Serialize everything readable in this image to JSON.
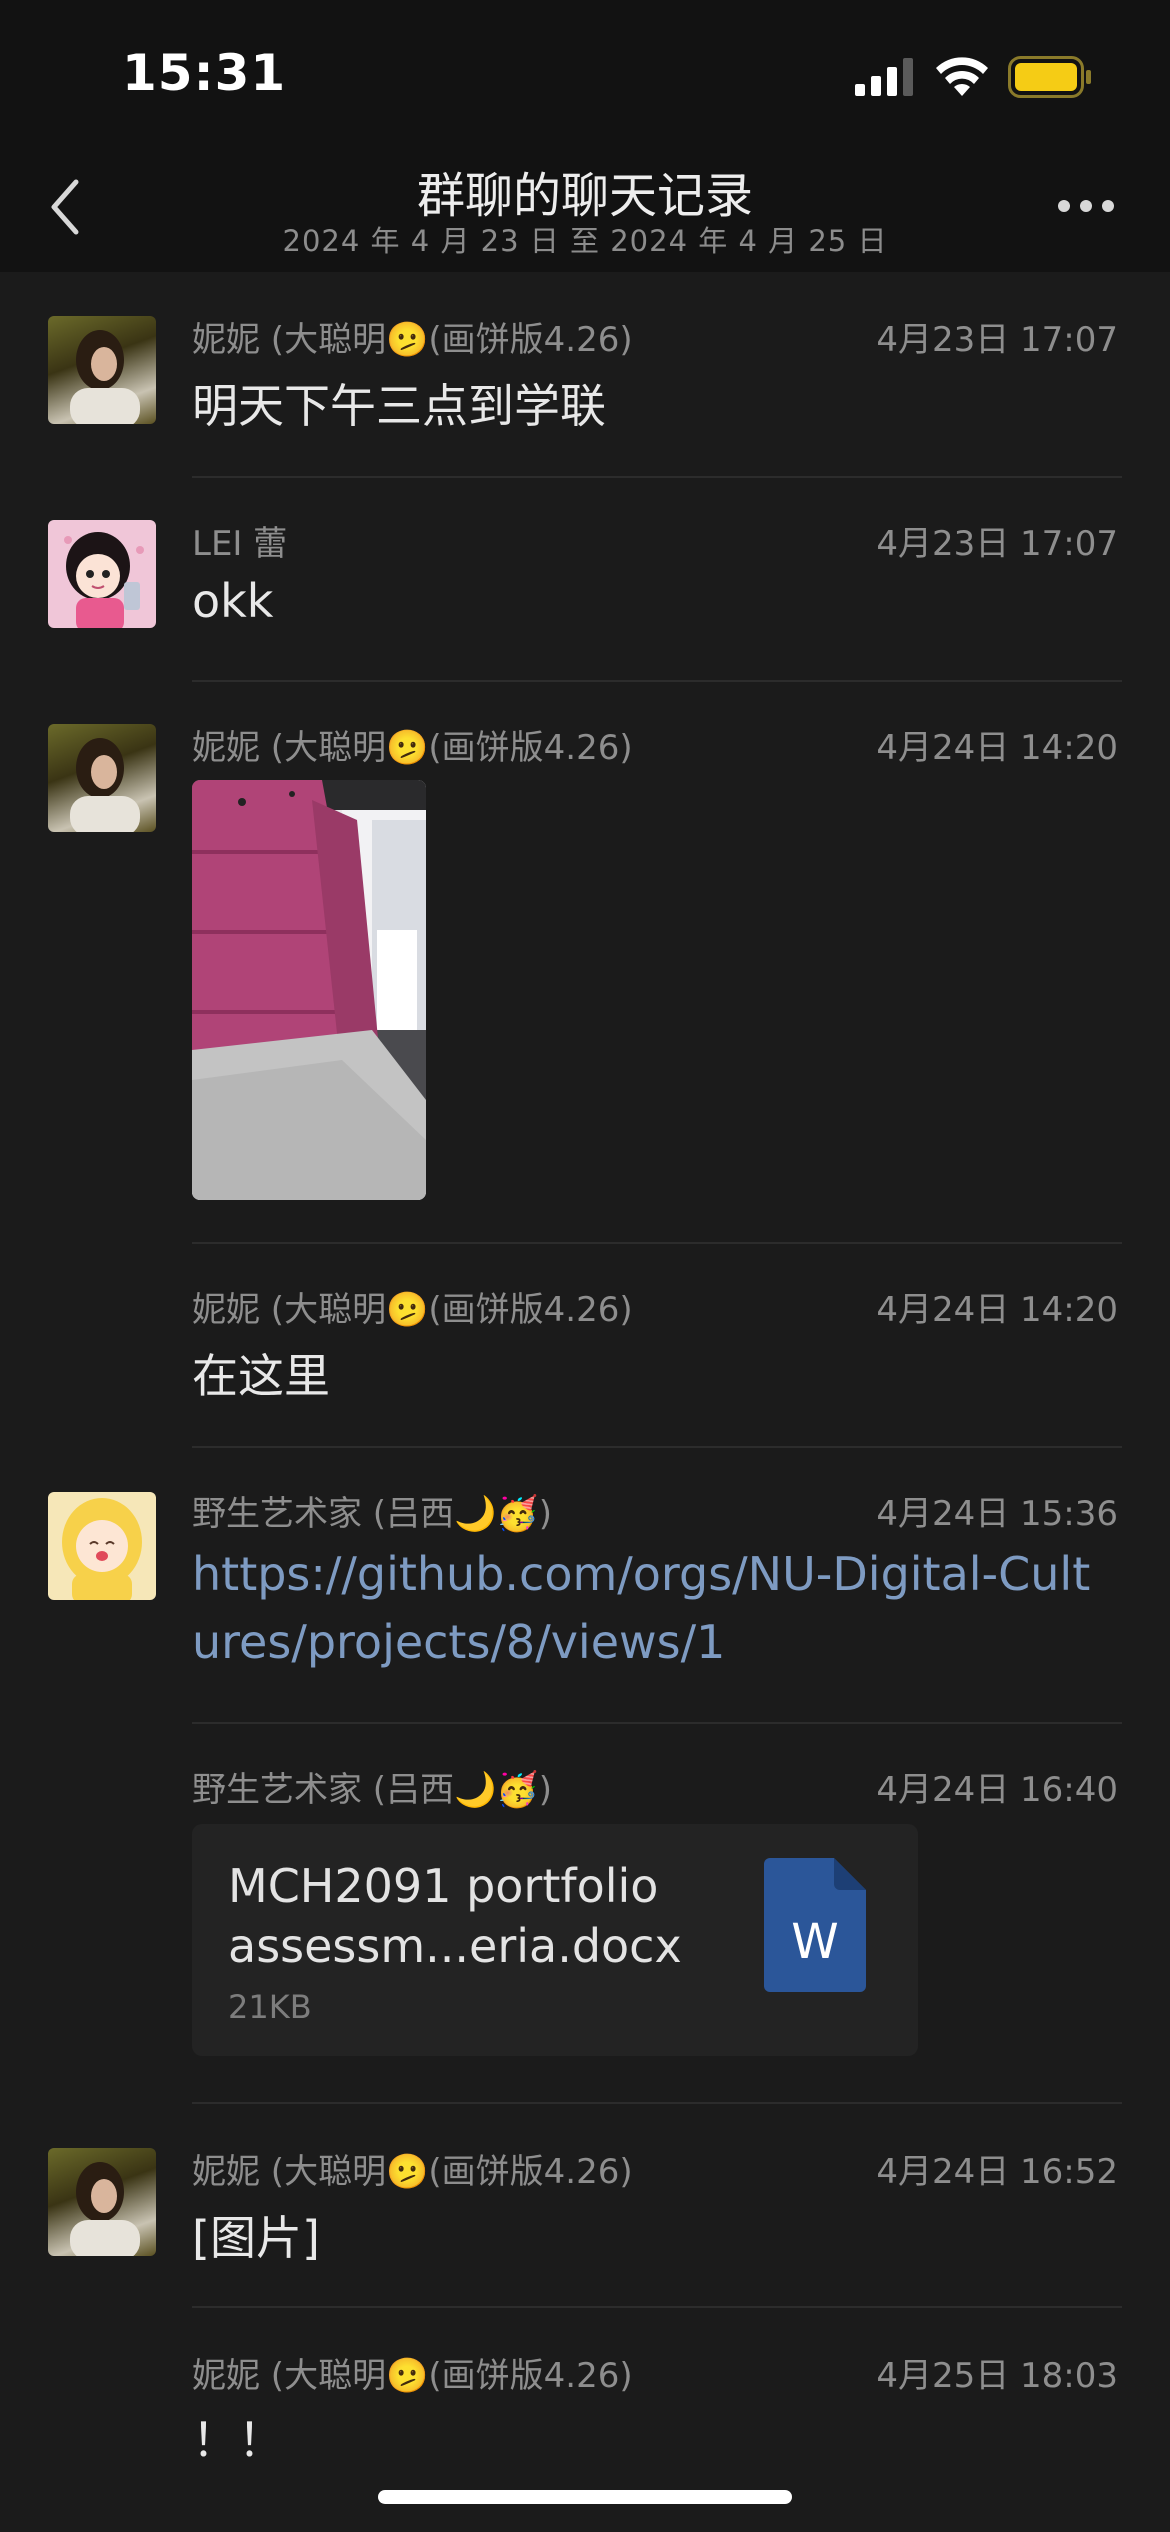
{
  "status_bar": {
    "time": "15:31"
  },
  "header": {
    "title": "群聊的聊天记录",
    "subtitle": "2024 年 4 月 23 日 至 2024 年 4 月 25 日"
  },
  "messages": [
    {
      "sender": "妮妮 (大聪明🫤(画饼版4.26)",
      "time": "4月23日 17:07",
      "text": "明天下午三点到学联"
    },
    {
      "sender": "LEI 蕾",
      "time": "4月23日 17:07",
      "text": "okk"
    },
    {
      "sender": "妮妮 (大聪明🫤(画饼版4.26)",
      "time": "4月24日 14:20"
    },
    {
      "sender": "妮妮 (大聪明🫤(画饼版4.26)",
      "time": "4月24日 14:20",
      "text": "在这里"
    },
    {
      "sender": "野生艺术家 (吕西🌙🥳)",
      "time": "4月24日 15:36",
      "text": "https://github.com/orgs/NU-Digital-Cultures/projects/8/views/1"
    },
    {
      "sender": "野生艺术家 (吕西🌙🥳)",
      "time": "4月24日 16:40",
      "file_name": "MCH2091 portfolio assessm...eria.docx",
      "file_size": "21KB",
      "file_icon_letter": "W"
    },
    {
      "sender": "妮妮 (大聪明🫤(画饼版4.26)",
      "time": "4月24日 16:52",
      "text": "[图片]"
    },
    {
      "sender": "妮妮 (大聪明🫤(画饼版4.26)",
      "time": "4月25日 18:03",
      "text": "！！"
    }
  ],
  "colors": {
    "background": "#1b1b1b",
    "bar": "#121212",
    "link": "#7e9bc2",
    "battery": "#f5cc15",
    "word_icon": "#2b5699"
  },
  "icons": [
    "back-chevron-icon",
    "more-dots-icon",
    "cellular-signal-icon",
    "wifi-icon",
    "battery-icon",
    "word-document-icon"
  ]
}
